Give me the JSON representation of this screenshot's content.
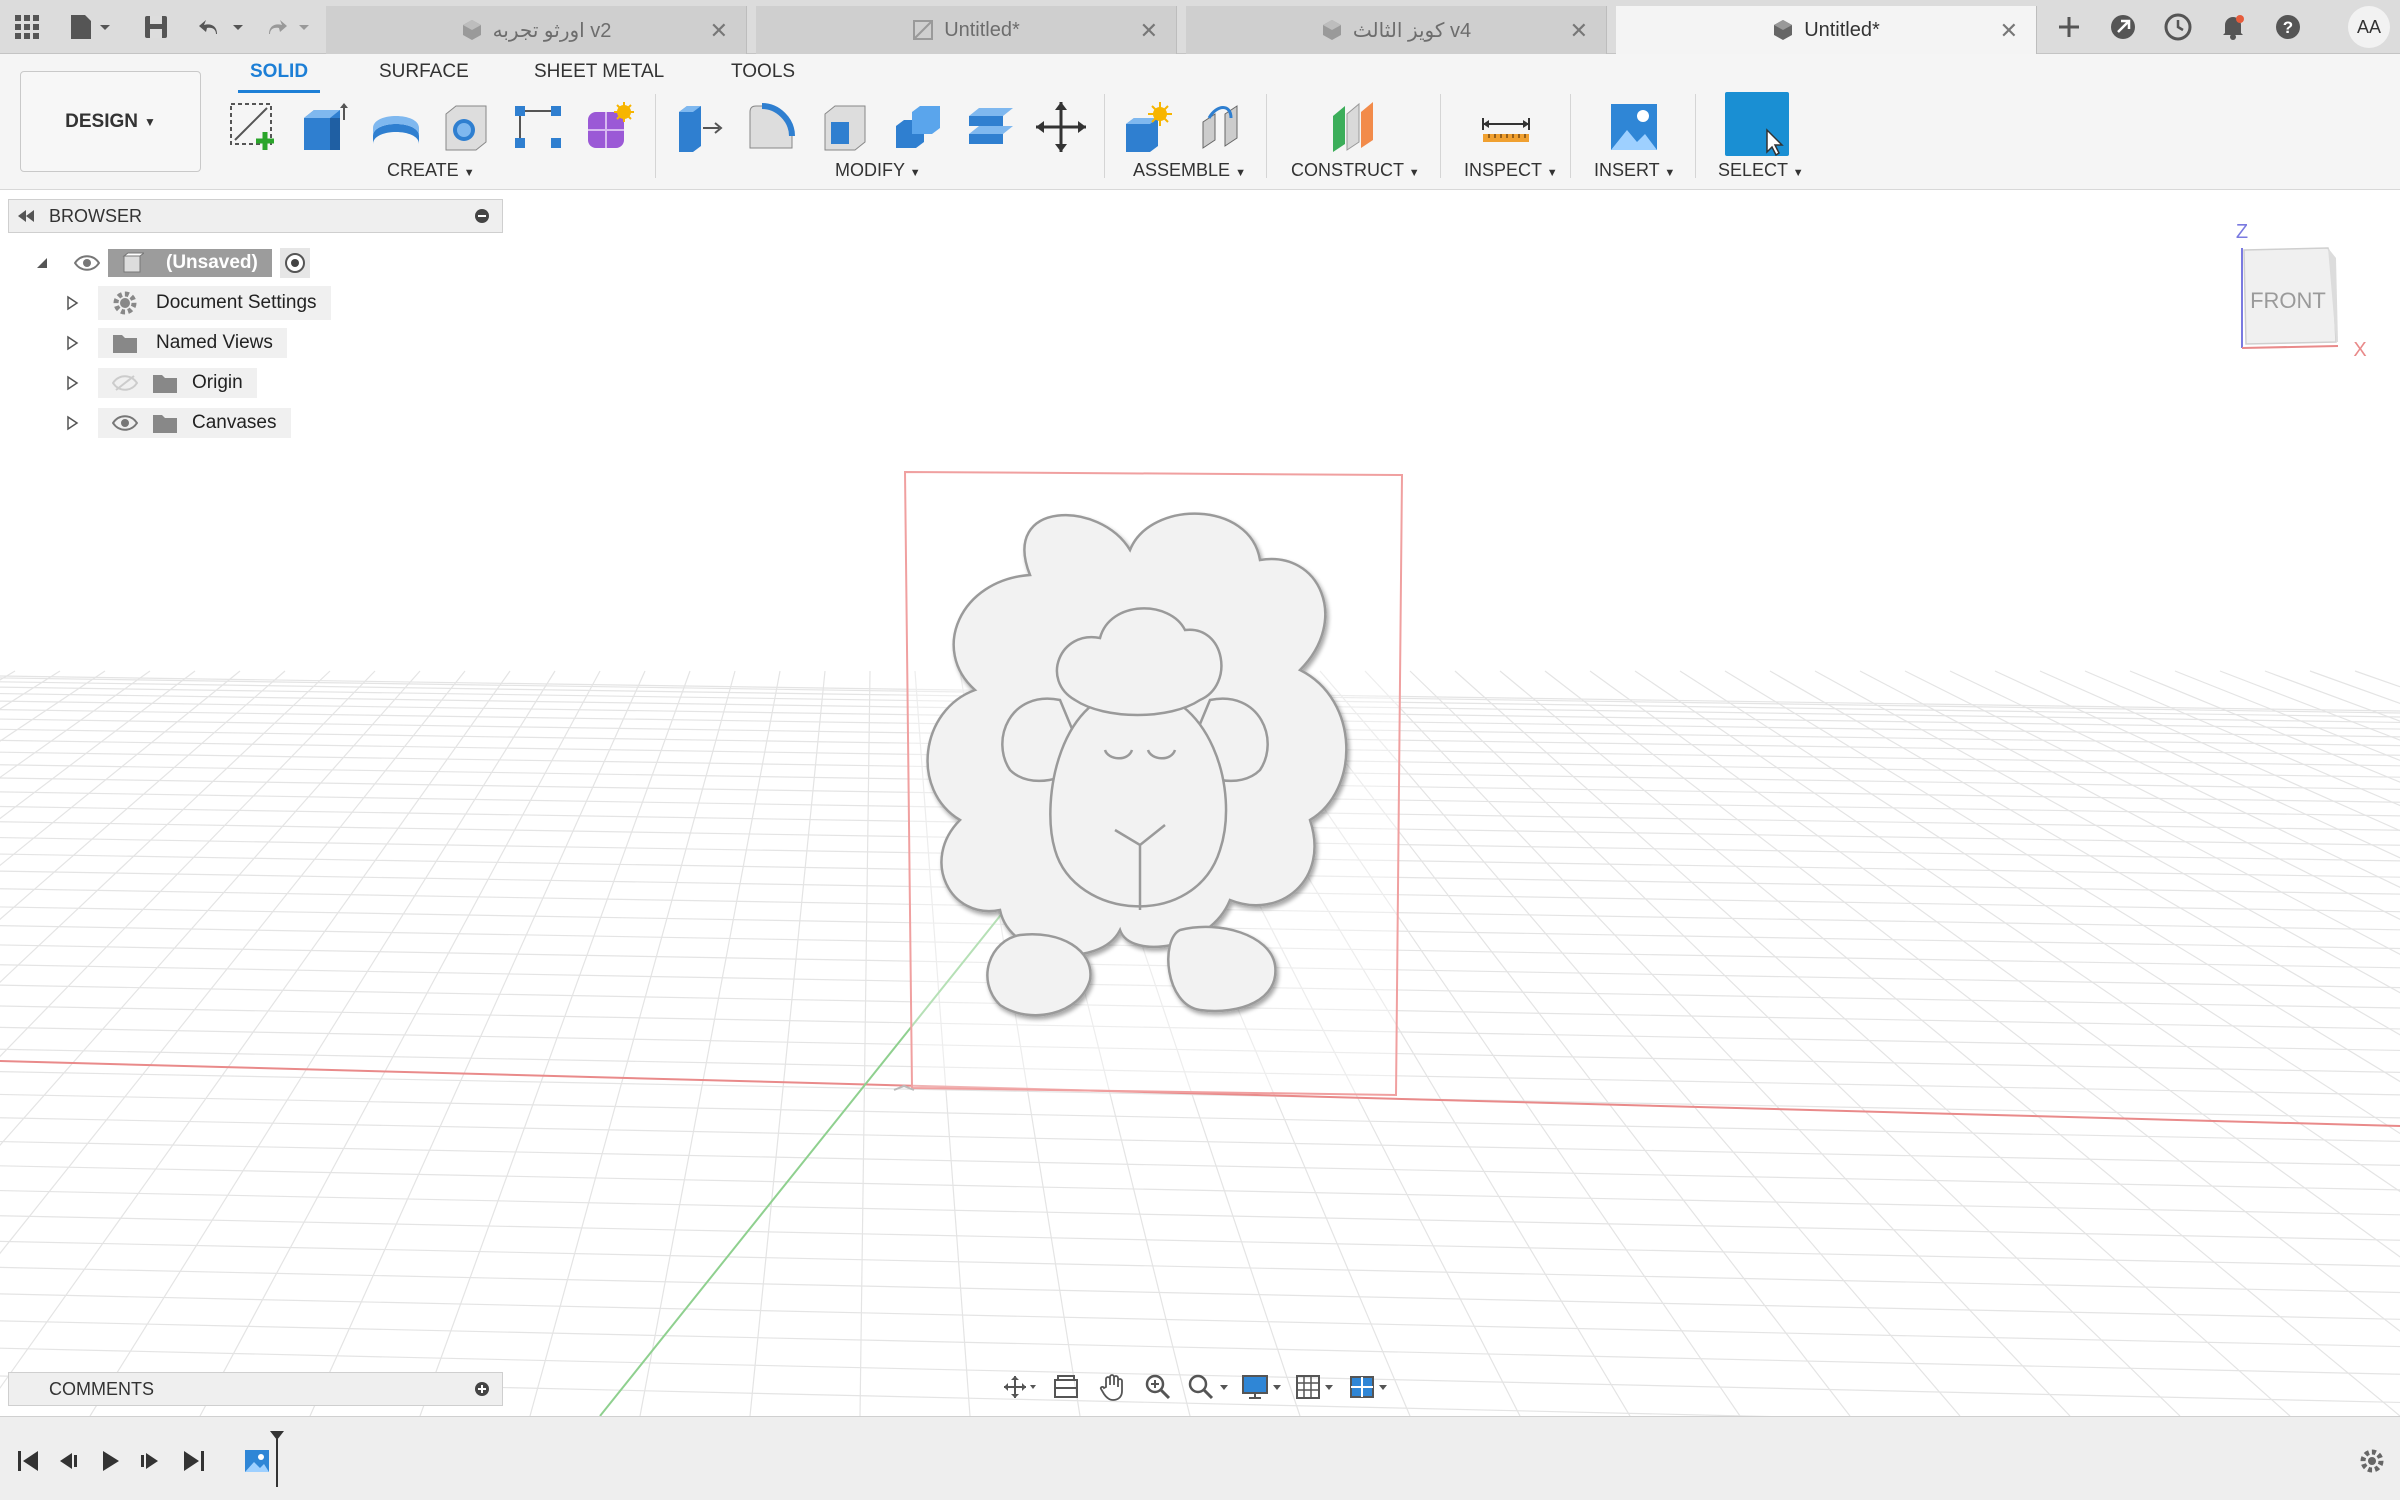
{
  "tabs": [
    {
      "label": "اورثو تجربه v2",
      "active": false
    },
    {
      "label": "Untitled*",
      "active": false
    },
    {
      "label": "كويز الثالث v4",
      "active": false
    },
    {
      "label": "Untitled*",
      "active": true
    }
  ],
  "user_initials": "AA",
  "workspace_button": "DESIGN",
  "mode_tabs": [
    "SOLID",
    "SURFACE",
    "SHEET METAL",
    "TOOLS"
  ],
  "groups": {
    "create": "CREATE",
    "modify": "MODIFY",
    "assemble": "ASSEMBLE",
    "construct": "CONSTRUCT",
    "inspect": "INSPECT",
    "insert": "INSERT",
    "select": "SELECT"
  },
  "browser": {
    "title": "BROWSER",
    "root": "(Unsaved)",
    "items": [
      "Document Settings",
      "Named Views",
      "Origin",
      "Canvases"
    ]
  },
  "viewcube": {
    "face": "FRONT",
    "axis_z": "Z",
    "axis_x": "X"
  },
  "comments": {
    "title": "COMMENTS"
  },
  "colors": {
    "accent": "#1d7fd6",
    "select_active": "#1a8fd3",
    "x_axis": "#e98a8a",
    "y_axis": "#8fd08f"
  }
}
